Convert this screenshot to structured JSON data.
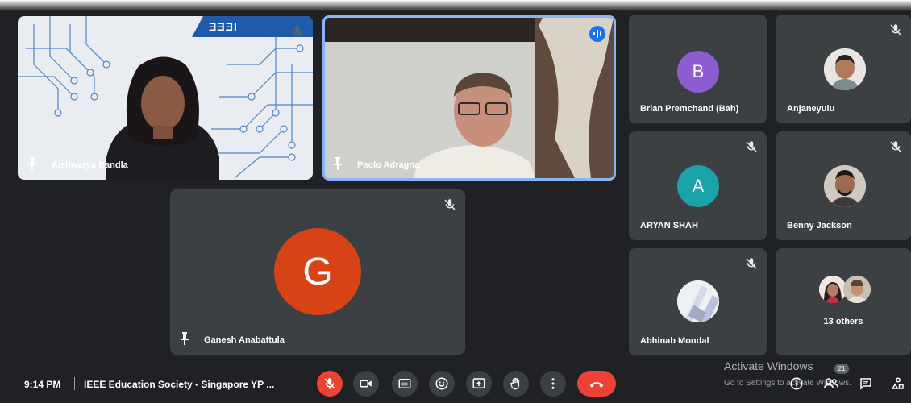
{
  "participants": {
    "aishwarya": {
      "name": "Aishwarya Bandla"
    },
    "paolo": {
      "name": "Paolo Adragna"
    },
    "ganesh": {
      "name": "Ganesh Anabattula",
      "initial": "G"
    },
    "brian": {
      "name": "Brian Premchand (Bah)",
      "initial": "B"
    },
    "anjaneyulu": {
      "name": "Anjaneyulu"
    },
    "aryan": {
      "name": "ARYAN SHAH",
      "initial": "A"
    },
    "benny": {
      "name": "Benny Jackson"
    },
    "abhinab": {
      "name": "Abhinab Mondal"
    },
    "others": {
      "label": "13 others"
    }
  },
  "logo": {
    "text": "IEEE"
  },
  "bottom_bar": {
    "time": "9:14 PM",
    "separator": "|",
    "meeting_title": "IEEE Education Society - Singapore YP ...",
    "participant_count": "21"
  },
  "watermark": {
    "line1": "Activate Windows",
    "line2": "Go to Settings to activate Windows."
  },
  "colors": {
    "background": "#202124",
    "tile": "#3c4043",
    "avatar_b": "#8e5cd1",
    "avatar_a": "#1aa3a8",
    "avatar_g": "#d84315",
    "speaking_border": "#8ab4f8",
    "end_call": "#ea4335",
    "ieee_blue": "#1f5ba8"
  },
  "icons": {
    "muted": "mic-off-icon",
    "pin": "pin-icon",
    "speaking": "audio-level-icon",
    "mic": "mic-off-icon",
    "camera": "camera-icon",
    "captions": "captions-icon",
    "emoji": "emoji-icon",
    "present": "present-icon",
    "hand": "raise-hand-icon",
    "more": "more-options-icon",
    "hangup": "hangup-icon",
    "info": "info-icon",
    "people": "people-icon",
    "chat": "chat-icon",
    "activities": "activities-icon"
  }
}
